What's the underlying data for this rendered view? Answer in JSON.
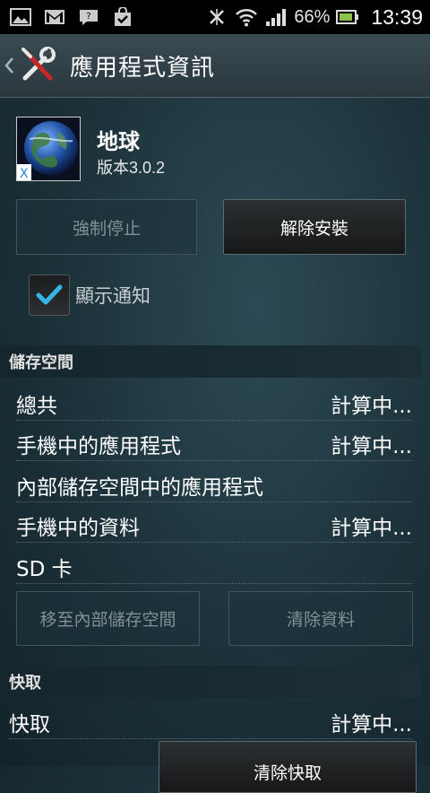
{
  "status_bar": {
    "icons_left": [
      "gallery-icon",
      "gmail-icon",
      "message-icon",
      "bag-icon"
    ],
    "battery_percent": "66%",
    "time": "13:39"
  },
  "title_bar": {
    "title": "應用程式資訊"
  },
  "app": {
    "name": "地球",
    "version": "版本3.0.2"
  },
  "buttons": {
    "force_stop": "強制停止",
    "uninstall": "解除安裝",
    "move_to_internal": "移至內部儲存空間",
    "clear_data": "清除資料",
    "clear_cache": "清除快取"
  },
  "notification": {
    "label": "顯示通知",
    "checked": true
  },
  "storage": {
    "header": "儲存空間",
    "rows": [
      {
        "label": "總共",
        "value": "計算中..."
      },
      {
        "label": "手機中的應用程式",
        "value": "計算中..."
      },
      {
        "label": "內部儲存空間中的應用程式",
        "value": ""
      },
      {
        "label": "手機中的資料",
        "value": "計算中..."
      },
      {
        "label": "SD 卡",
        "value": ""
      }
    ]
  },
  "cache": {
    "header": "快取",
    "rows": [
      {
        "label": "快取",
        "value": "計算中..."
      }
    ]
  },
  "colors": {
    "accent_check": "#33b5e5",
    "battery_green": "#8bc34a"
  }
}
